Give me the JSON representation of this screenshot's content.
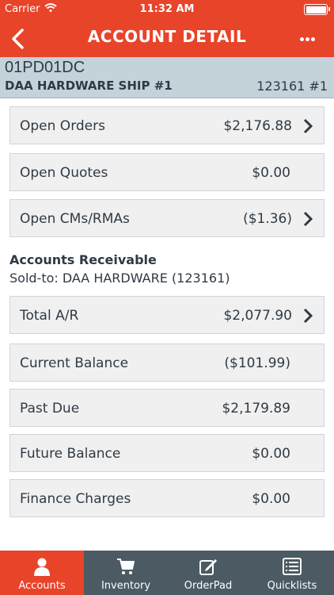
{
  "status_bar": {
    "carrier": "Carrier",
    "time": "11:32 AM"
  },
  "nav": {
    "title": "ACCOUNT DETAIL",
    "back_icon": "chevron-left-icon",
    "more_icon": "more-dots-icon"
  },
  "account": {
    "code": "01PD01DC",
    "name": "DAA HARDWARE SHIP #1",
    "number": "123161 #1"
  },
  "summary_rows": [
    {
      "label": "Open Orders",
      "value": "$2,176.88",
      "has_chevron": true
    },
    {
      "label": "Open Quotes",
      "value": "$0.00",
      "has_chevron": false
    },
    {
      "label": "Open CMs/RMAs",
      "value": "($1.36)",
      "has_chevron": true
    }
  ],
  "receivable": {
    "heading": "Accounts Receivable",
    "sold_to": "Sold-to: DAA HARDWARE (123161)",
    "rows": [
      {
        "label": "Total A/R",
        "value": "$2,077.90",
        "has_chevron": true
      },
      {
        "label": "Current Balance",
        "value": "($101.99)",
        "has_chevron": false
      },
      {
        "label": "Past Due",
        "value": "$2,179.89",
        "has_chevron": false
      },
      {
        "label": "Future Balance",
        "value": "$0.00",
        "has_chevron": false
      },
      {
        "label": "Finance Charges",
        "value": "$0.00",
        "has_chevron": false
      }
    ]
  },
  "tabs": [
    {
      "label": "Accounts",
      "icon": "person-icon",
      "active": true
    },
    {
      "label": "Inventory",
      "icon": "cart-icon",
      "active": false
    },
    {
      "label": "OrderPad",
      "icon": "edit-icon",
      "active": false
    },
    {
      "label": "Quicklists",
      "icon": "list-icon",
      "active": false
    }
  ],
  "colors": {
    "accent": "#e8442a",
    "tabbar": "#4b5a63",
    "account_bar": "#c4d2da",
    "row_bg": "#f0f0f0",
    "text": "#2f3a44"
  }
}
